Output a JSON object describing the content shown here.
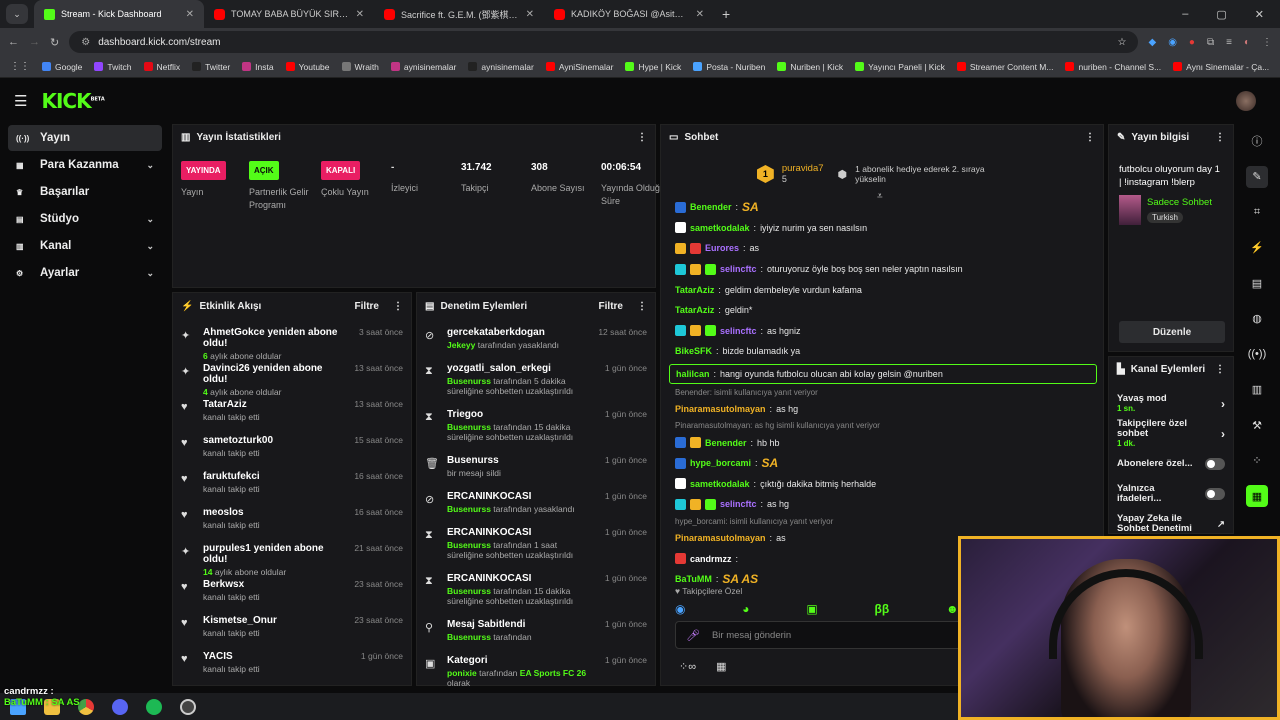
{
  "browser": {
    "tabs": [
      {
        "title": "Stream - Kick Dashboard",
        "fav": "k",
        "active": true
      },
      {
        "title": "TOMAY BABA BÜYÜK SIRRI ÇÖZ",
        "fav": "y",
        "active": false
      },
      {
        "title": "Sacrifice ft. G.E.M. (鄧紫棋) (Re",
        "fav": "y",
        "active": false
      },
      {
        "title": "KADIKÖY BOĞASI @Asitmen İLE",
        "fav": "y",
        "active": false
      }
    ],
    "url": "dashboard.kick.com/stream",
    "bookmarks": [
      "Google",
      "Twitch",
      "Netflix",
      "Twitter",
      "Insta",
      "Youtube",
      "Wraith",
      "aynisinemalar",
      "aynisinemalar",
      "AyniSinemalar",
      "Hype | Kick",
      "Posta - Nuriben",
      "Nuriben | Kick",
      "Yayıncı Paneli | Kick",
      "Streamer Content M...",
      "nuriben - Channel S...",
      "Aynı Sinemalar - Ça..."
    ]
  },
  "kick": {
    "logo": "KICK",
    "beta": "BETA"
  },
  "sidebar": {
    "items": [
      {
        "label": "Yayın",
        "icon": "broadcast-icon",
        "chev": false
      },
      {
        "label": "Para Kazanma",
        "icon": "money-icon",
        "chev": true
      },
      {
        "label": "Başarılar",
        "icon": "trophy-icon",
        "chev": false
      },
      {
        "label": "Stüdyo",
        "icon": "studio-icon",
        "chev": true
      },
      {
        "label": "Kanal",
        "icon": "channel-icon",
        "chev": true
      },
      {
        "label": "Ayarlar",
        "icon": "gear-icon",
        "chev": true
      }
    ]
  },
  "stats": {
    "title": "Yayın İstatistikleri",
    "items": [
      {
        "value": "YAYINDA",
        "label": "Yayın",
        "type": "red"
      },
      {
        "value": "AÇIK",
        "label": "Partnerlik Gelir Programı",
        "type": "green"
      },
      {
        "value": "KAPALI",
        "label": "Çoklu Yayın",
        "type": "red"
      },
      {
        "value": "-",
        "label": "İzleyici",
        "type": "dash"
      },
      {
        "value": "31.742",
        "label": "Takipçi",
        "type": "val"
      },
      {
        "value": "308",
        "label": "Abone Sayısı",
        "type": "val"
      },
      {
        "value": "00:06:54",
        "label": "Yayında Olduğu Süre",
        "type": "val"
      }
    ]
  },
  "events": {
    "title": "Etkinlik Akışı",
    "filter": "Filtre",
    "items": [
      {
        "name": "AhmetGokce yeniden abone oldu!",
        "num": "6",
        "sub": " aylık abone oldular",
        "time": "3 saat önce",
        "icon": "sparkle-icon"
      },
      {
        "name": "Davinci26 yeniden abone oldu!",
        "num": "4",
        "sub": " aylık abone oldular",
        "time": "13 saat önce",
        "icon": "sparkle-icon"
      },
      {
        "name": "TatarAziz",
        "num": "",
        "sub": "kanalı takip etti",
        "time": "13 saat önce",
        "icon": "heart-icon"
      },
      {
        "name": "sametozturk00",
        "num": "",
        "sub": "kanalı takip etti",
        "time": "15 saat önce",
        "icon": "heart-icon"
      },
      {
        "name": "faruktufekci",
        "num": "",
        "sub": "kanalı takip etti",
        "time": "16 saat önce",
        "icon": "heart-icon"
      },
      {
        "name": "meoslos",
        "num": "",
        "sub": "kanalı takip etti",
        "time": "16 saat önce",
        "icon": "heart-icon"
      },
      {
        "name": "purpules1 yeniden abone oldu!",
        "num": "14",
        "sub": " aylık abone oldular",
        "time": "21 saat önce",
        "icon": "sparkle-icon"
      },
      {
        "name": "Berkwsx",
        "num": "",
        "sub": "kanalı takip etti",
        "time": "23 saat önce",
        "icon": "heart-icon"
      },
      {
        "name": "Kismetse_Onur",
        "num": "",
        "sub": "kanalı takip etti",
        "time": "23 saat önce",
        "icon": "heart-icon"
      },
      {
        "name": "YACIS",
        "num": "",
        "sub": "kanalı takip etti",
        "time": "1 gün önce",
        "icon": "heart-icon"
      }
    ]
  },
  "moderation": {
    "title": "Denetim Eylemleri",
    "filter": "Filtre",
    "items": [
      {
        "name": "gercekataberkdogan",
        "by": "Jekeyy",
        "desc": " tarafından yasaklandı",
        "time": "12 saat önce",
        "icon": "ban-icon"
      },
      {
        "name": "yozgatli_salon_erkegi",
        "by": "Busenurss",
        "desc": " tarafından 5 dakika süreliğine sohbetten uzaklaştırıldı",
        "time": "1 gün önce",
        "icon": "hourglass-icon"
      },
      {
        "name": "Triegoo",
        "by": "Busenurss",
        "desc": " tarafından 15 dakika süreliğine sohbetten uzaklaştırıldı",
        "time": "1 gün önce",
        "icon": "hourglass-icon"
      },
      {
        "name": "Busenurss",
        "by": "",
        "desc": "bir mesajı sildi",
        "time": "1 gün önce",
        "icon": "trash-icon"
      },
      {
        "name": "ERCANINKOCASI",
        "by": "Busenurss",
        "desc": " tarafından yasaklandı",
        "time": "1 gün önce",
        "icon": "ban-icon"
      },
      {
        "name": "ERCANINKOCASI",
        "by": "Busenurss",
        "desc": " tarafından 1 saat süreliğine sohbetten uzaklaştırıldı",
        "time": "1 gün önce",
        "icon": "hourglass-icon"
      },
      {
        "name": "ERCANINKOCASI",
        "by": "Busenurss",
        "desc": " tarafından 15 dakika süreliğine sohbetten uzaklaştırıldı",
        "time": "1 gün önce",
        "icon": "hourglass-icon"
      },
      {
        "name": "Mesaj Sabitlendi",
        "by": "Busenurss",
        "desc": " tarafından",
        "time": "1 gün önce",
        "icon": "pin-icon"
      },
      {
        "name": "Kategori",
        "by": "ponixie",
        "desc": " tarafından ",
        "extra": "EA Sports FC 26",
        "extra2": " olarak",
        "time": "1 gün önce",
        "icon": "category-icon"
      }
    ]
  },
  "chat": {
    "title": "Sohbet",
    "top_user": "puravida7",
    "top_count": "5",
    "top_rank": "1",
    "gift_text": "1 abonelik hediye ederek 2. sıraya yükselin",
    "messages": [
      {
        "user": "Benender",
        "color": "#53fc18",
        "text": "SA",
        "badges": [
          "#2a6cd6"
        ]
      },
      {
        "user": "sametkodalak",
        "color": "#53fc18",
        "text": "iyiyiz nurim ya sen nasılsın",
        "badges": [
          "#ffffff"
        ]
      },
      {
        "user": "Eurores",
        "color": "#a970ff",
        "text": "as",
        "badges": [
          "#f0b225",
          "#e53935"
        ]
      },
      {
        "user": "selincftc",
        "color": "#a970ff",
        "text": "oturuyoruz öyle boş boş sen neler yaptın nasılsın",
        "badges": [
          "#1ec8d8",
          "#f0b225",
          "#53fc18"
        ]
      },
      {
        "user": "TatarAziz",
        "color": "#53fc18",
        "text": "geldim dembeleyle vurdun kafama",
        "badges": []
      },
      {
        "user": "TatarAziz",
        "color": "#53fc18",
        "text": "geldin*",
        "badges": []
      },
      {
        "user": "selincftc",
        "color": "#a970ff",
        "text": "as hgniz",
        "badges": [
          "#1ec8d8",
          "#f0b225",
          "#53fc18"
        ]
      },
      {
        "user": "BikeSFK",
        "color": "#53fc18",
        "text": "bizde bulamadık ya",
        "badges": []
      },
      {
        "user": "halilcan",
        "color": "#53fc18",
        "text": "hangi oyunda futbolcu olucan abi kolay gelsin @nuriben",
        "badges": [],
        "highlight": true
      },
      {
        "reply": "Benender: isimli kullanıcıya yanıt veriyor"
      },
      {
        "user": "Pinaramasutolmayan",
        "color": "#f0b225",
        "text": "as hg",
        "badges": []
      },
      {
        "reply": "Pinaramasutolmayan: as hg isimli kullanıcıya yanıt veriyor"
      },
      {
        "user": "Benender",
        "color": "#53fc18",
        "text": "hb hb",
        "badges": [
          "#2a6cd6",
          "#f0b225"
        ]
      },
      {
        "user": "hype_borcami",
        "color": "#53fc18",
        "text": "SA",
        "badges": [
          "#2a6cd6"
        ]
      },
      {
        "user": "sametkodalak",
        "color": "#53fc18",
        "text": "çıktığı dakika bitmiş herhalde",
        "badges": [
          "#ffffff"
        ]
      },
      {
        "user": "selincftc",
        "color": "#a970ff",
        "text": "as hg",
        "badges": [
          "#1ec8d8",
          "#f0b225",
          "#53fc18"
        ]
      },
      {
        "reply": "hype_borcami: isimli kullanıcıya yanıt veriyor"
      },
      {
        "user": "Pinaramasutolmayan",
        "color": "#f0b225",
        "text": "as",
        "badges": []
      },
      {
        "user": "candrmzz",
        "color": "#ffffff",
        "text": "",
        "badges": [
          "#e53935"
        ]
      },
      {
        "user": "BaTuMM",
        "color": "#53fc18",
        "text": "SA AS",
        "badges": []
      }
    ],
    "followers_only": "Takipçilere Özel",
    "input_placeholder": "Bir mesaj gönderin"
  },
  "info": {
    "title": "Yayın bilgisi",
    "stream_title": "futbolcu oluyorum day 1 | !instagram !blerp",
    "mode": "Sadece Sohbet",
    "language": "Turkish",
    "edit": "Düzenle"
  },
  "actions": {
    "title": "Kanal Eylemleri",
    "items": [
      {
        "label": "Yavaş mod",
        "sub": "1 sn.",
        "kind": "arrow"
      },
      {
        "label": "Takipçilere özel sohbet",
        "sub": "1 dk.",
        "kind": "arrow"
      },
      {
        "label": "Abonelere özel...",
        "sub": "",
        "kind": "toggle"
      },
      {
        "label": "Yalnızca ifadeleri...",
        "sub": "",
        "kind": "toggle"
      },
      {
        "label": "Yapay Zeka ile Sohbet Denetimi",
        "sub": "",
        "kind": "ext"
      }
    ]
  },
  "overlay": {
    "line1": "candrmzz :",
    "line2": "BaTuMM : SA AS"
  }
}
